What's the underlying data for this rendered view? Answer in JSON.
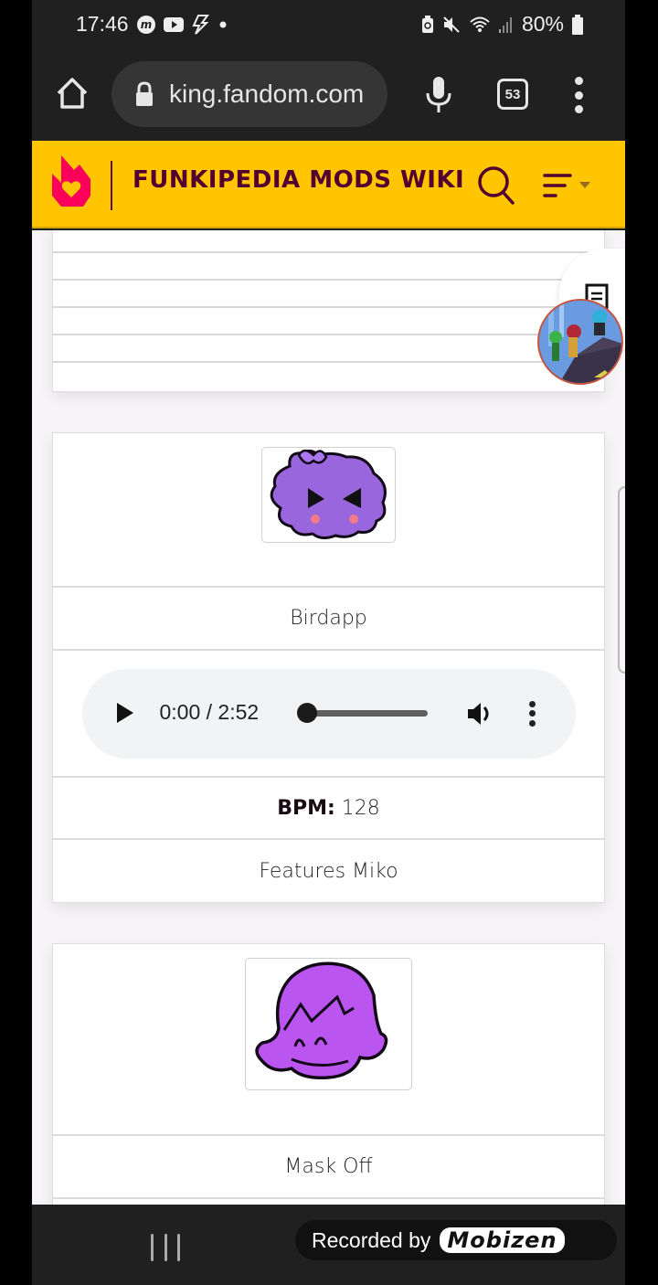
{
  "status_bar": {
    "time": "17:46",
    "left_icons": [
      "mobizen-icon",
      "youtube-icon",
      "flash-icon",
      "dot-icon"
    ],
    "right_icons": [
      "battery-saver-icon",
      "mute-icon",
      "wifi-icon",
      "signal-icon"
    ],
    "battery_percent": "80%"
  },
  "browser": {
    "url": "king.fandom.com",
    "tab_count": "53"
  },
  "wiki_header": {
    "title": "FUNKIPEDIA MODS WIKI",
    "brand_color": "#ffc500",
    "title_color": "#520032",
    "logo_color": "#fa005a"
  },
  "songs": [
    {
      "name": "Birdapp",
      "audio": {
        "current_time": "0:00",
        "duration": "2:52",
        "time_display": "0:00 / 2:52",
        "progress": 0
      },
      "bpm_label": "BPM:",
      "bpm_value": "128",
      "features": "Features Miko"
    },
    {
      "name": "Mask Off"
    }
  ],
  "recording_badge": {
    "text": "Recorded by",
    "brand": "Mobizen"
  }
}
